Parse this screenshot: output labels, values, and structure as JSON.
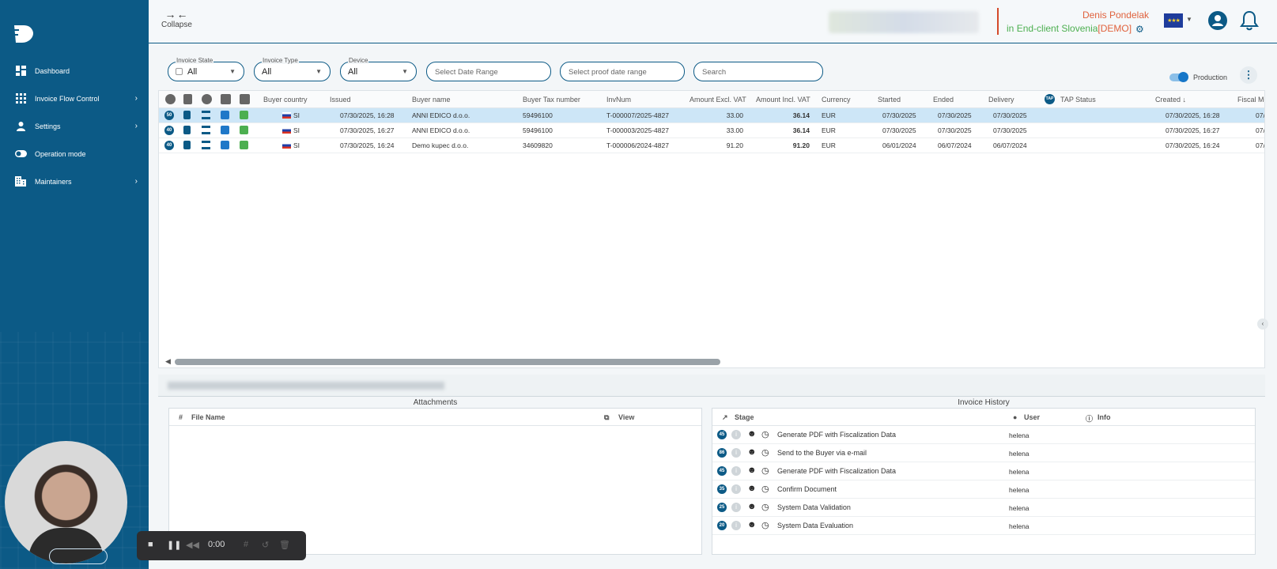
{
  "sidebar": {
    "items": [
      {
        "label": "Dashboard",
        "icon": "dashboard-icon",
        "chevron": false
      },
      {
        "label": "Invoice Flow Control",
        "icon": "grid-icon",
        "chevron": true
      },
      {
        "label": "Settings",
        "icon": "person-icon",
        "chevron": true
      },
      {
        "label": "Operation mode",
        "icon": "toggle-icon",
        "chevron": false
      },
      {
        "label": "Maintainers",
        "icon": "building-icon",
        "chevron": true
      }
    ]
  },
  "header": {
    "collapse_label": "Collapse",
    "user_name": "Denis Pondelak",
    "client_prefix": "in ",
    "client_name": "End-client Slovenia",
    "client_tag": "[DEMO]"
  },
  "filters": {
    "invoice_state": {
      "label": "Invoice State",
      "value": "All"
    },
    "invoice_type": {
      "label": "Invoice Type",
      "value": "All"
    },
    "device": {
      "label": "Device",
      "value": "All"
    },
    "date_range_placeholder": "Select Date Range",
    "proof_date_placeholder": "Select proof date range",
    "search_placeholder": "Search",
    "production_label": "Production"
  },
  "table": {
    "columns": {
      "buyer_country": "Buyer country",
      "issued": "Issued",
      "buyer_name": "Buyer name",
      "buyer_tax": "Buyer Tax number",
      "invnum": "InvNum",
      "amount_excl": "Amount Excl. VAT",
      "amount_incl": "Amount Incl. VAT",
      "currency": "Currency",
      "started": "Started",
      "ended": "Ended",
      "delivery": "Delivery",
      "tap_status": "TAP Status",
      "created": "Created",
      "fiscal": "Fiscal Mo"
    },
    "tap_badge": "TAP",
    "rows": [
      {
        "badge": "50",
        "country": "SI",
        "issued": "07/30/2025, 16:28",
        "buyer": "ANNI EDICO d.o.o.",
        "tax": "59496100",
        "inv": "T-000007/2025-4827",
        "excl": "33.00",
        "incl": "36.14",
        "cur": "EUR",
        "started": "07/30/2025",
        "ended": "07/30/2025",
        "delivery": "07/30/2025",
        "created": "07/30/2025, 16:28",
        "fiscal": "07/"
      },
      {
        "badge": "40",
        "country": "SI",
        "issued": "07/30/2025, 16:27",
        "buyer": "ANNI EDICO d.o.o.",
        "tax": "59496100",
        "inv": "T-000003/2025-4827",
        "excl": "33.00",
        "incl": "36.14",
        "cur": "EUR",
        "started": "07/30/2025",
        "ended": "07/30/2025",
        "delivery": "07/30/2025",
        "created": "07/30/2025, 16:27",
        "fiscal": "07/"
      },
      {
        "badge": "40",
        "country": "SI",
        "issued": "07/30/2025, 16:24",
        "buyer": "Demo kupec d.o.o.",
        "tax": "34609820",
        "inv": "T-000006/2024-4827",
        "excl": "91.20",
        "incl": "91.20",
        "cur": "EUR",
        "started": "06/01/2024",
        "ended": "06/07/2024",
        "delivery": "06/07/2024",
        "created": "07/30/2025, 16:24",
        "fiscal": "07/"
      }
    ]
  },
  "attachments": {
    "title": "Attachments",
    "col_file": "File Name",
    "col_view": "View"
  },
  "history": {
    "title": "Invoice History",
    "col_stage": "Stage",
    "col_user": "User",
    "col_info": "Info",
    "rows": [
      {
        "stage": "45",
        "text": "Generate PDF with Fiscalization Data",
        "user": "helena"
      },
      {
        "stage": "86",
        "text": "Send to the Buyer via e-mail",
        "user": "helena"
      },
      {
        "stage": "45",
        "text": "Generate PDF with Fiscalization Data",
        "user": "helena"
      },
      {
        "stage": "35",
        "text": "Confirm Document",
        "user": "helena"
      },
      {
        "stage": "25",
        "text": "System Data Validation",
        "user": "helena"
      },
      {
        "stage": "20",
        "text": "System Data Evaluation",
        "user": "helena"
      }
    ]
  },
  "recorder": {
    "time": "0:00"
  },
  "colors": {
    "sidebar": "#0c5a86",
    "accent": "#e0623d",
    "green": "#4caf50",
    "selected_row": "#cde6f7"
  }
}
